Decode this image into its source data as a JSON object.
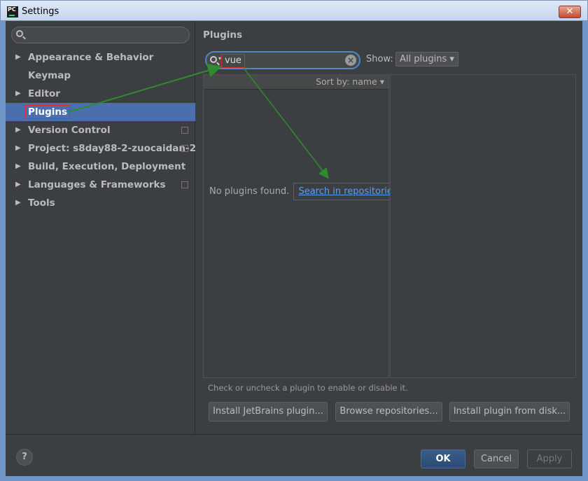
{
  "window": {
    "title": "Settings",
    "close_label": "✕"
  },
  "sidebar": {
    "items": [
      {
        "label": "Appearance & Behavior",
        "expandable": true
      },
      {
        "label": "Keymap",
        "expandable": false
      },
      {
        "label": "Editor",
        "expandable": true
      },
      {
        "label": "Plugins",
        "expandable": false,
        "selected": true
      },
      {
        "label": "Version Control",
        "expandable": true
      },
      {
        "label": "Project: s8day88-2-zuocaidan-2",
        "expandable": true
      },
      {
        "label": "Build, Execution, Deployment",
        "expandable": true
      },
      {
        "label": "Languages & Frameworks",
        "expandable": true
      },
      {
        "label": "Tools",
        "expandable": true
      }
    ]
  },
  "main": {
    "title": "Plugins",
    "search_value": "vue",
    "show_label": "Show:",
    "show_value": "All plugins ▾",
    "sort_label": "Sort by: name ▾",
    "empty_text": "No plugins found.",
    "search_repo_link": "Search in repositories",
    "hint": "Check or uncheck a plugin to enable or disable it.",
    "buttons": {
      "install_jetbrains": "Install JetBrains plugin...",
      "browse": "Browse repositories...",
      "install_disk": "Install plugin from disk..."
    }
  },
  "footer": {
    "help": "?",
    "ok": "OK",
    "cancel": "Cancel",
    "apply": "Apply"
  },
  "colors": {
    "accent": "#4b6eaf",
    "annotation_arrow": "#2e8b2e",
    "annotation_box": "#e0282e",
    "link": "#589df6"
  }
}
